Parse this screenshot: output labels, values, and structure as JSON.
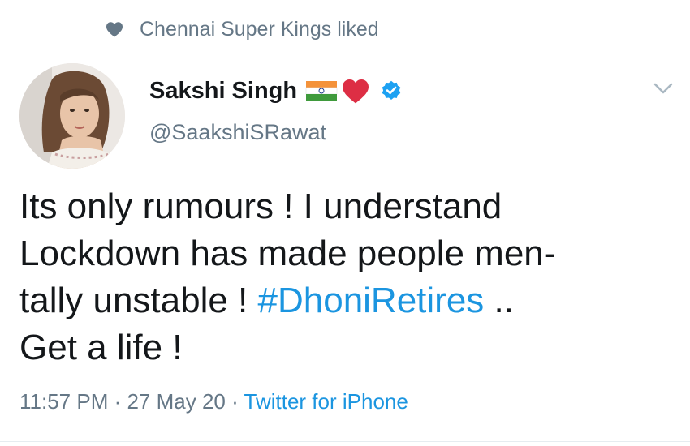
{
  "social_context": {
    "text": "Chennai Super Kings liked",
    "icon": "heart-icon"
  },
  "author": {
    "display_name": "Sakshi Singh",
    "handle": "@SaakshiSRawat",
    "emojis": [
      "india-flag-emoji",
      "red-heart-emoji"
    ],
    "verified": true
  },
  "tweet": {
    "lines": [
      "Its only rumours ! I understand",
      "Lockdown has made people men-",
      "tally unstable ! "
    ],
    "hashtag": "#DhoniRetires",
    "after_hashtag": " ..",
    "last_line": "Get a life !"
  },
  "meta": {
    "time": "11:57 PM",
    "separator": " · ",
    "date": "27 May 20",
    "source": "Twitter for iPhone"
  },
  "colors": {
    "link": "#1b95e0",
    "secondary_text": "#657786",
    "verified": "#1da1f2",
    "heart": "#e0245e"
  }
}
